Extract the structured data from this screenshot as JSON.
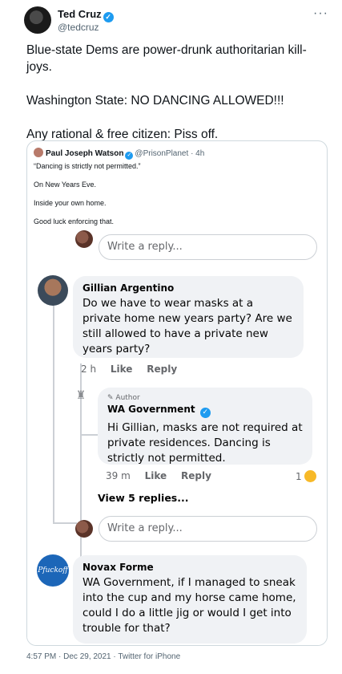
{
  "tweet": {
    "display_name": "Ted Cruz",
    "handle": "@tedcruz",
    "more_icon": "more-dots-icon",
    "lines": [
      "Blue-state Dems are power-drunk authoritarian kill-joys.",
      "Washington State:  NO DANCING ALLOWED!!!",
      "Any rational & free citizen: Piss off."
    ],
    "timestamp": "4:57 PM · Dec 29, 2021 · Twitter for iPhone"
  },
  "quote": {
    "name": "Paul Joseph Watson",
    "handle": "@PrisonPlanet",
    "age": "· 4h",
    "lines": [
      "“Dancing is strictly not permitted.”",
      "On New Years Eve.",
      "Inside your own home.",
      "Good luck enforcing that."
    ]
  },
  "fb_comments": {
    "reply_placeholder": "Write a reply...",
    "gillian": {
      "name": "Gillian Argentino",
      "text": "Do we have to wear masks at a private home new years party?  Are we still allowed to have a private new years party?",
      "time": "2 h",
      "like": "Like",
      "reply": "Reply"
    },
    "wa": {
      "author_label": "Author",
      "name": "WA Government",
      "text": "Hi Gillian, masks are not required at private residences. Dancing is strictly not permitted.",
      "time": "39 m",
      "like": "Like",
      "reply": "Reply",
      "reaction_count": "1",
      "reaction_icon": "laughing-emoji-icon"
    },
    "view_replies": "View 5 replies...",
    "novax": {
      "logo_text": "Pfuckoff",
      "name": "Novax Forme",
      "text": "WA Government, if I managed to sneak into the cup and my horse came home, could I do a little jig or would I get into trouble for that?"
    }
  },
  "colors": {
    "twitter_blue": "#1d9bf0",
    "fb_bubble": "#f0f2f5",
    "secondary_text": "#536471"
  }
}
